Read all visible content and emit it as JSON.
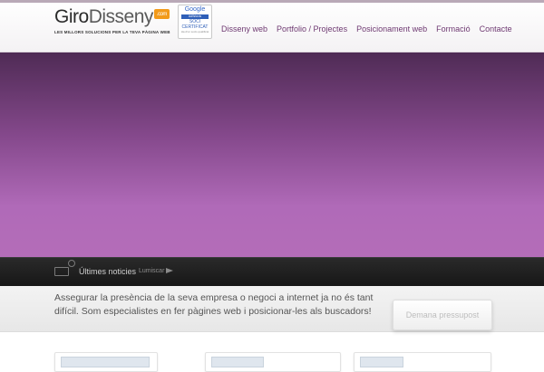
{
  "brand": {
    "name_part1": "Giro",
    "name_part2": "Disseny",
    "domain_badge": ".com",
    "tagline": "LES MILLORS SOLUCIONS PER LA TEVA PÀGINA WEB",
    "accent_color": "#f29a1a"
  },
  "google_badge": {
    "line1": "Google",
    "line2": "AdWords",
    "line3": "SOCI",
    "line4": "CERTIFICAT",
    "line5": "Ha d'un socis qualificat"
  },
  "nav": {
    "items": [
      {
        "label": "Disseny web"
      },
      {
        "label": "Portfolio / Projectes"
      },
      {
        "label": "Posicionament web"
      },
      {
        "label": "Formació"
      },
      {
        "label": "Contacte"
      }
    ]
  },
  "hero": {
    "color_top": "#4f2b55",
    "color_bottom": "#b46db8"
  },
  "news": {
    "title": "Últimes noticies",
    "item": "Lumiscar",
    "icons": [
      "tv-icon",
      "clock-icon",
      "arrow-icon"
    ]
  },
  "promo": {
    "text": "Assegurar la presència de la seva empresa o negoci a internet ja no és tant difícil. Som especialistes en fer pàgines web i posicionar-les als buscadors!",
    "button_label": "Demana pressupost"
  }
}
